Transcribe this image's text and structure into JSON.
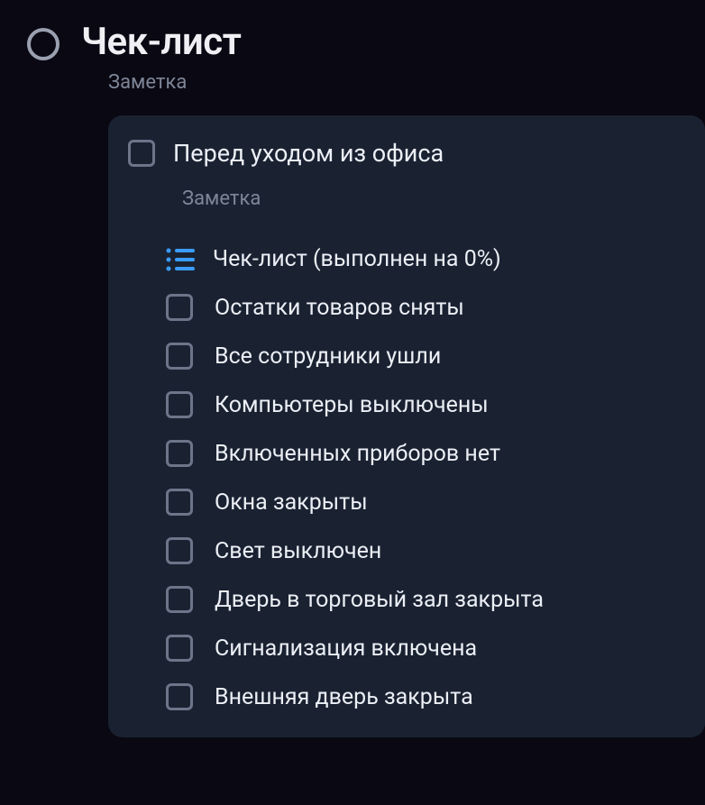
{
  "header": {
    "title": "Чек-лист",
    "subtitle": "Заметка"
  },
  "card": {
    "title": "Перед уходом из офиса",
    "subtitle": "Заметка",
    "checklist": {
      "title": "Чек-лист (выполнен на 0%)",
      "items": [
        {
          "label": "Остатки товаров сняты"
        },
        {
          "label": "Все сотрудники ушли"
        },
        {
          "label": "Компьютеры выключены"
        },
        {
          "label": "Включенных приборов нет"
        },
        {
          "label": "Окна закрыты"
        },
        {
          "label": "Свет выключен"
        },
        {
          "label": "Дверь в торговый зал закрыта"
        },
        {
          "label": "Сигнализация включена"
        },
        {
          "label": "Внешняя дверь закрыта"
        }
      ]
    }
  },
  "colors": {
    "accent": "#3b9cff"
  }
}
